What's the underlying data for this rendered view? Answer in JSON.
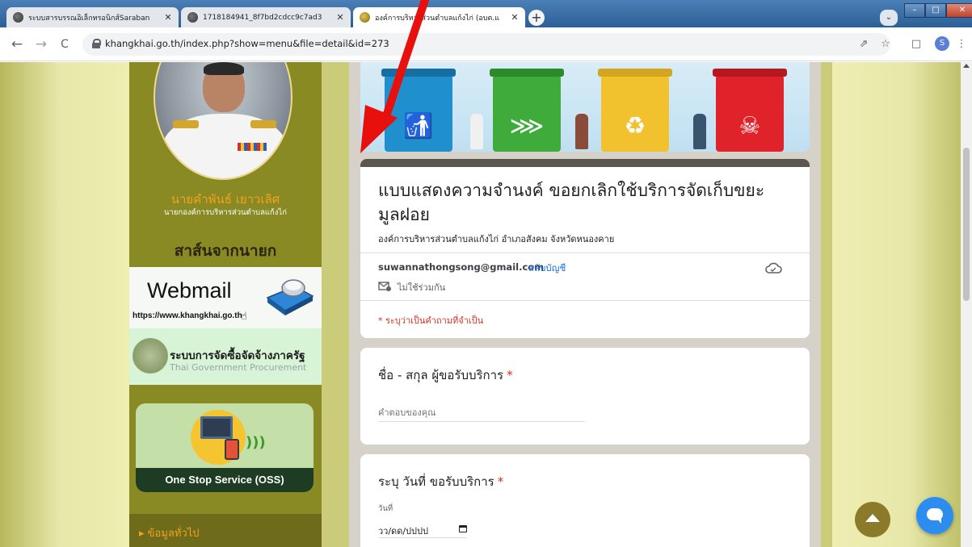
{
  "browser": {
    "tabs": [
      {
        "title": "ระบบสารบรรณอิเล็กทรอนิกส์Saraban",
        "icon": "globe-icon",
        "active": false
      },
      {
        "title": "1718184941_8f7bd2cdcc9c7ad3",
        "icon": "globe-icon",
        "active": false
      },
      {
        "title": "องค์การบริหารส่วนตำบลแก้งไก่ (อบต.แ",
        "icon": "site-favicon-icon",
        "active": true
      }
    ],
    "new_tab": "+",
    "tab_search": "⌄",
    "window_controls": {
      "minimize": "–",
      "maximize": "□",
      "close": "✕"
    },
    "nav": {
      "back": "←",
      "forward": "→",
      "reload": "C"
    },
    "url": "khangkhai.go.th/index.php?show=menu&file=detail&id=273",
    "toolbar_icons": {
      "share": "⇗",
      "bookmark": "☆",
      "sidebar": "□",
      "menu": "⋮"
    },
    "profile_initial": "S"
  },
  "sidebar": {
    "person_name": "นายคำพันธ์ เยาวเลิศ",
    "person_title": "นายกองค์การบริหารส่วนตำบลแก้งไก่",
    "message_banner": "สาส์นจากนายก",
    "webmail_title": "Webmail",
    "webmail_url": "https://www.khangkhai.go.th",
    "procurement_th": "ระบบการจัดซื้อจัดจ้างภาครัฐ",
    "procurement_en": "Thai Government Procurement",
    "oss_label": "One Stop Service (OSS)",
    "general_info": "▸ ข้อมูลทั่วไป"
  },
  "form": {
    "title": "แบบแสดงความจำนงค์ ขอยกเลิกใช้บริการจัดเก็บขยะมูลฝอย",
    "description": "องค์การบริหารส่วนตำบลแก้งไก่ อำเภอสังคม จังหวัดหนองคาย",
    "account_email": "suwannathongsong@gmail.com",
    "switch_account": "สลับบัญชี",
    "not_shared": "ไม่ใช้ร่วมกัน",
    "required_note": "* ระบุว่าเป็นคำถามที่จำเป็น",
    "questions": [
      {
        "title": "ชื่อ - สกุล ผู้ขอรับบริการ",
        "required_mark": "*",
        "placeholder": "คำตอบของคุณ"
      },
      {
        "title": "ระบุ วันที่ ขอรับบริการ",
        "required_mark": "*",
        "date_label": "วันที่",
        "date_placeholder": "วว/ดด/ปปปป"
      }
    ]
  },
  "colors": {
    "form_accent": "#5b5650",
    "required": "#d93025",
    "link": "#1a73e8",
    "sidebar": "#8a8a24",
    "annotation_arrow": "#e8100c"
  }
}
